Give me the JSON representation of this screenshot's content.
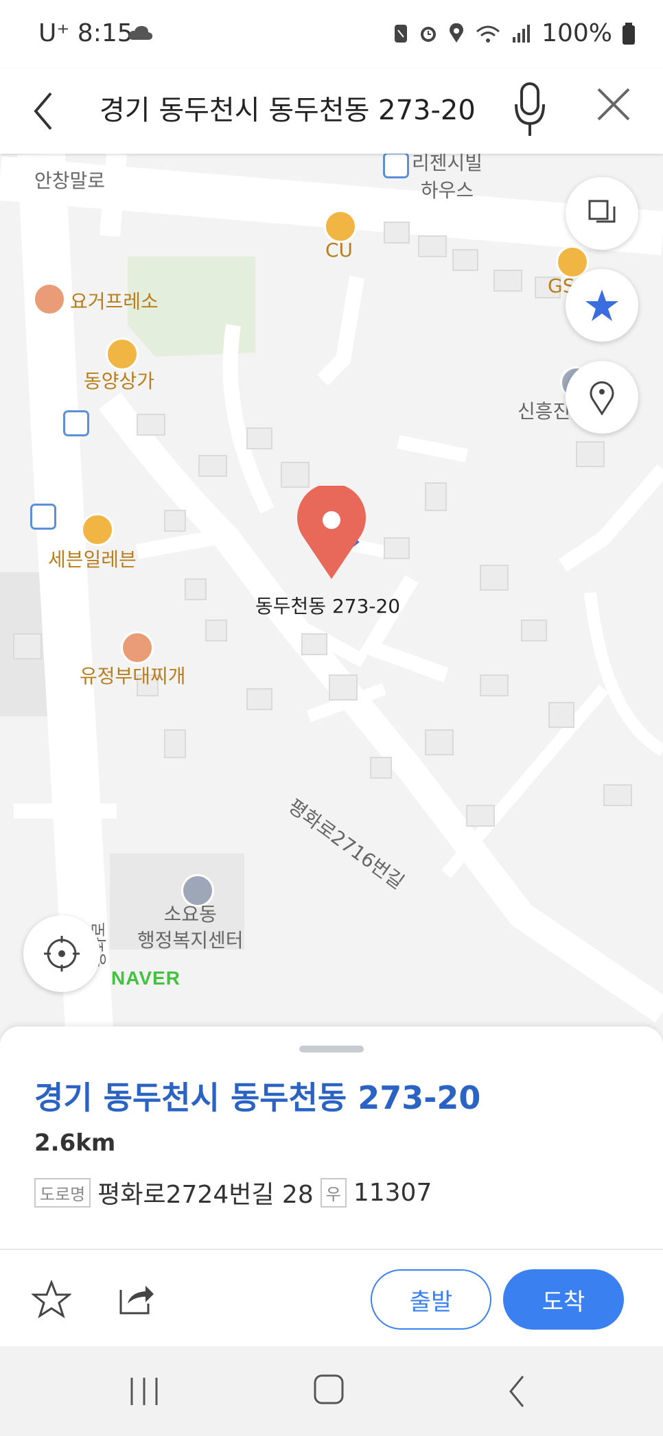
{
  "status_bar": {
    "time": "U⁺ 8:15",
    "battery": "100%",
    "icons": [
      "cloud-icon",
      "nfc-icon",
      "alarm-icon",
      "location-icon",
      "wifi-icon",
      "signal-icon",
      "battery-icon"
    ]
  },
  "search": {
    "query": "경기 동두천시 동두천동 273-20",
    "icons": [
      "back-arrow-icon",
      "microphone-icon",
      "close-icon"
    ]
  },
  "map": {
    "pois": [
      {
        "name": "리젠시빌\n하우스",
        "kind": "building"
      },
      {
        "name": "안창말로",
        "kind": "road"
      },
      {
        "name": "CU",
        "kind": "store"
      },
      {
        "name": "GS",
        "kind": "store"
      },
      {
        "name": "요거프레소",
        "kind": "cafe"
      },
      {
        "name": "동양상가",
        "kind": "shopping"
      },
      {
        "name": "신흥진",
        "kind": "building"
      },
      {
        "name": "세븐일레븐",
        "kind": "store"
      },
      {
        "name": "유정부대찌개",
        "kind": "restaurant"
      },
      {
        "name": "평화로2716번길",
        "kind": "road"
      },
      {
        "name": "소요동\n행정복지센터",
        "kind": "government"
      },
      {
        "name": "평화로",
        "kind": "road"
      }
    ],
    "marker_label": "동두천동 273-20",
    "watermark": "NAVER",
    "buttons": [
      "layers-button",
      "favorites-button",
      "location-pin-button",
      "current-location-button"
    ]
  },
  "place": {
    "title": "경기 동두천시 동두천동 273-20",
    "distance": "2.6km",
    "road_tag": "도로명",
    "road_address": "평화로2724번길 28",
    "postal_tag": "우",
    "postal_code": "11307"
  },
  "actions": {
    "start": "출발",
    "arrive": "도착"
  },
  "colors": {
    "accent": "#3a80f0",
    "title_blue": "#2b63c4",
    "marker_red": "#e8685a",
    "poi_label": "#b87e1d"
  }
}
